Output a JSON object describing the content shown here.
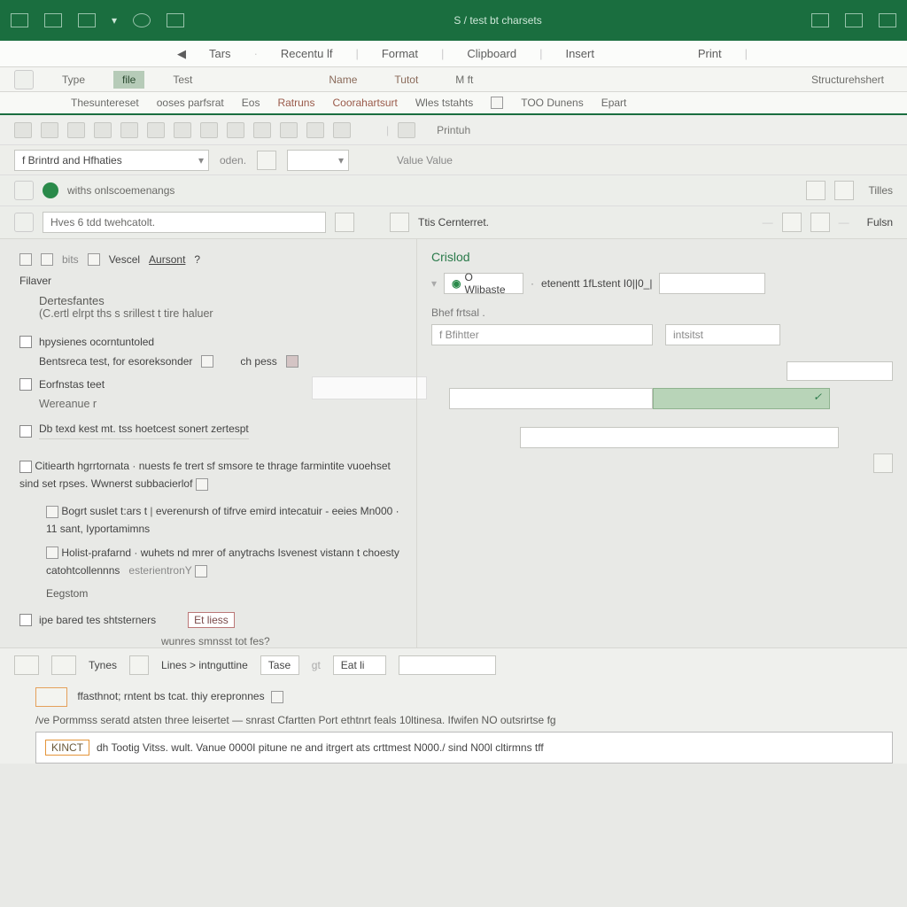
{
  "titlebar": {
    "center": "S / test bt charsets"
  },
  "menubar": {
    "nav_prev": "◀",
    "tabs": "Tars",
    "recent": "Recentu lf",
    "format": "Format",
    "clipboard": "Clipboard",
    "insert": "Insert",
    "print": "Print"
  },
  "tabs1": {
    "type": "Type",
    "test": "Test",
    "name": "Name",
    "tutor": "Tutot",
    "mft": "M ft",
    "structure": "Structurehshert"
  },
  "tabs2": {
    "t0": "Thesuntereset",
    "t1": "ooses parfsrat",
    "t2": "Eos",
    "t3": "Ratruns",
    "t4": "Coorahartsurt",
    "t5": "Wles tstahts",
    "t6": "TOO Dunens",
    "t7": "Epart"
  },
  "toolstrip": {
    "lbl": "Printuh",
    "vv": "Value Value"
  },
  "row2": {
    "combo": "f Brintrd and Hfhaties",
    "oden": "oden."
  },
  "row3": {
    "left": "withs onlscoemenangs",
    "right": "Tilles"
  },
  "row4": {
    "input": "Hves 6 tdd twehcatolt.",
    "rlabel": "Ttis Cernterret.",
    "fuser": "Fulsn"
  },
  "left": {
    "hdr_tools": [
      "bits",
      "Vescel",
      "Aursont",
      "?"
    ],
    "fever": "Filaver",
    "d": "Dertesfantes",
    "d_sub": "(C.ertl elrpt ths s srillest t tire haluer",
    "c1": "hpysienes ocorntuntoled",
    "c1_sub": "Bentsreca test, for esoreksonder",
    "c1_ch": "ch pess",
    "c2": "Eorfnstas teet",
    "c2_sub": "Wereanue r",
    "c3": "Db texd kest mt. tss hoetcest sonert zertespt",
    "c4": "Citiearth hgrrtornata",
    "c4_rest": "nuests fe trert sf smsore te thrage farmintite vuoehset sind set rpses. Wwnerst subbacierlof",
    "b1": "Bogrt suslet t:ars t",
    "b1_rest": "everenursh of tifrve emird intecatuir - eeies Mn000 · 11 sant, Iyportamimns",
    "b2": "Holist-prafarnd",
    "b2_rest": "wuhets nd mrer of anytrachs Isvenest vistann t choesty catohtcollennns",
    "b2_end": "esterientronY",
    "region": "Eegstom",
    "c5": "ipe bared tes shtsterners",
    "c5_btn": "Et liess",
    "c5_sub": "wunres smnsst tot fes?"
  },
  "right": {
    "hdr": "Crislod",
    "db": "O Wlibaste",
    "db_val": "etenentt 1fLstent I0||0_|",
    "lbl1": "Bhef frtsal .",
    "f1": "f Bfihtter",
    "f2": "intsitst"
  },
  "footer": {
    "types": "Tynes",
    "lines": "Lines > intnguttine",
    "tase": "Tase",
    "eatii": "Eat li",
    "msg1": "ffasthnot; rntent bs tcat. thiy erepronnes",
    "msg2": "/ve Pormmss seratd atsten three leisertet — snrast Cfartten Port ethtnrt feals  10ltinesa. Ifwifen NO outsrirtse fg",
    "msg3_btn": "KINCT",
    "msg3": "dh  Tootig Vitss.  wult. Vanue 0000I  pitune ne and itrgert ats crttmest  N000./ sind N00l cltirmns tff"
  }
}
